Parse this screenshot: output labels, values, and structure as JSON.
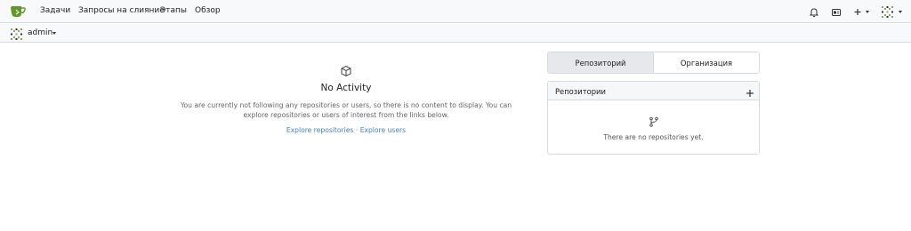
{
  "navbar": {
    "logo_icon": "gitea-tea-icon",
    "items": [
      {
        "label": "Задачи"
      },
      {
        "label": "Запросы на слияние"
      },
      {
        "label": "Этапы"
      },
      {
        "label": "Обзор"
      }
    ],
    "right_icons": [
      "bell-icon",
      "inbox-icon",
      "plus-icon",
      "avatar"
    ]
  },
  "context": {
    "user": "admin"
  },
  "feed": {
    "icon": "cube-icon",
    "title": "No Activity",
    "description": "You are currently not following any repositories or users, so there is no content to display. You can explore repositories or users of interest from the links below.",
    "explore_repos": "Explore repositories",
    "separator": "·",
    "explore_users": "Explore users"
  },
  "tabs": {
    "repositories": "Репозиторий",
    "organizations": "Организация",
    "active": "repositories"
  },
  "repo_panel": {
    "title": "Репозитории",
    "empty_text": "There are no repositories yet."
  },
  "colors": {
    "accent": "#4183c4",
    "logo_green": "#609926"
  }
}
